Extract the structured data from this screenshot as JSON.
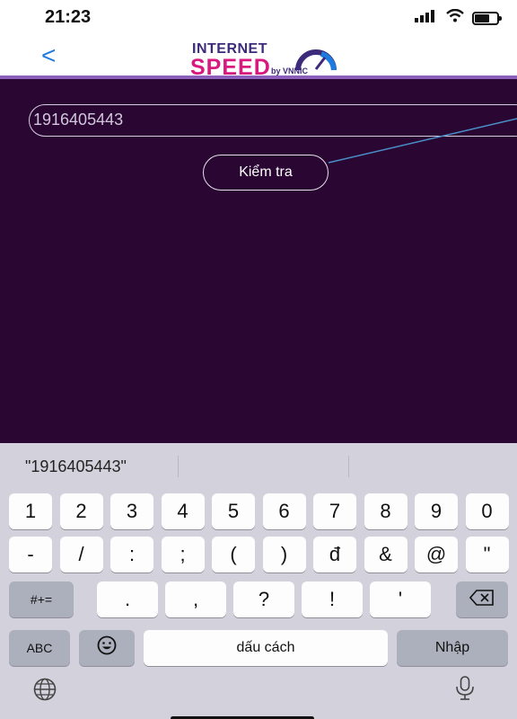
{
  "status_bar": {
    "time": "21:23",
    "signal_icon": "signal-bars-icon",
    "wifi_icon": "wifi-icon",
    "battery_icon": "battery-icon"
  },
  "header": {
    "back_label": "<",
    "logo_top": "INTERNET",
    "logo_bottom": "SPEED",
    "logo_by": "by VNNIC"
  },
  "main": {
    "input_value": "1916405443",
    "check_button_label": "Kiểm tra",
    "background_color": "#2a0733"
  },
  "keyboard": {
    "suggestion": "\"1916405443\"",
    "row1": [
      "1",
      "2",
      "3",
      "4",
      "5",
      "6",
      "7",
      "8",
      "9",
      "0"
    ],
    "row2": [
      "-",
      "/",
      ":",
      ";",
      "(",
      ")",
      "đ",
      "&",
      "@",
      "\""
    ],
    "row3": {
      "shift_label": "#+=",
      "keys": [
        ".",
        ",",
        "?",
        "!",
        "'"
      ],
      "delete_icon": "backspace-icon"
    },
    "row4": {
      "abc_label": "ABC",
      "emoji_icon": "emoji-icon",
      "space_label": "dấu cách",
      "return_label": "Nhập"
    },
    "bottom": {
      "globe_icon": "globe-icon",
      "mic_icon": "microphone-icon"
    }
  }
}
